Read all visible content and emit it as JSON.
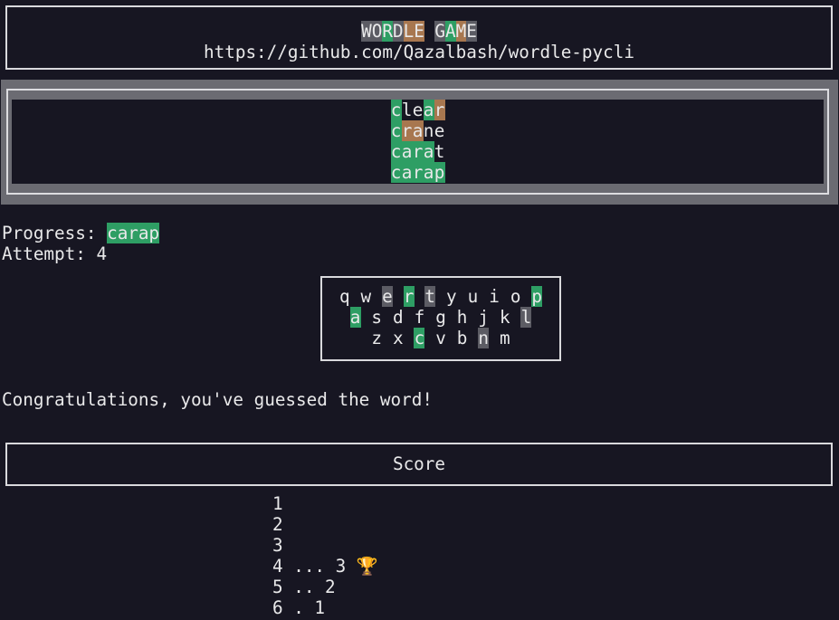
{
  "header": {
    "title_letters": [
      {
        "ch": "W",
        "c": "d"
      },
      {
        "ch": "O",
        "c": "d"
      },
      {
        "ch": "R",
        "c": "g"
      },
      {
        "ch": "D",
        "c": "d"
      },
      {
        "ch": "L",
        "c": "y"
      },
      {
        "ch": "E",
        "c": "y"
      },
      {
        "ch": " ",
        "c": "n"
      },
      {
        "ch": "G",
        "c": "d"
      },
      {
        "ch": "A",
        "c": "g"
      },
      {
        "ch": "M",
        "c": "y"
      },
      {
        "ch": "E",
        "c": "d"
      }
    ],
    "repo_url": "https://github.com/Qazalbash/wordle-pycli"
  },
  "board": {
    "guesses": [
      [
        {
          "ch": "c",
          "c": "g"
        },
        {
          "ch": "l",
          "c": "n"
        },
        {
          "ch": "e",
          "c": "n"
        },
        {
          "ch": "a",
          "c": "g"
        },
        {
          "ch": "r",
          "c": "y"
        }
      ],
      [
        {
          "ch": "c",
          "c": "g"
        },
        {
          "ch": "r",
          "c": "y"
        },
        {
          "ch": "a",
          "c": "y"
        },
        {
          "ch": "n",
          "c": "n"
        },
        {
          "ch": "e",
          "c": "n"
        }
      ],
      [
        {
          "ch": "c",
          "c": "g"
        },
        {
          "ch": "a",
          "c": "g"
        },
        {
          "ch": "r",
          "c": "g"
        },
        {
          "ch": "a",
          "c": "g"
        },
        {
          "ch": "t",
          "c": "n"
        }
      ],
      [
        {
          "ch": "c",
          "c": "g"
        },
        {
          "ch": "a",
          "c": "g"
        },
        {
          "ch": "r",
          "c": "g"
        },
        {
          "ch": "a",
          "c": "g"
        },
        {
          "ch": "p",
          "c": "g"
        }
      ]
    ]
  },
  "status": {
    "progress_label": "Progress: ",
    "progress_word": "carap",
    "attempt_text": "Attempt: 4",
    "congrats": "Congratulations, you've guessed the word!"
  },
  "keyboard": {
    "rows": [
      [
        {
          "ch": "q",
          "c": "n"
        },
        {
          "ch": "w",
          "c": "n"
        },
        {
          "ch": "e",
          "c": "d"
        },
        {
          "ch": "r",
          "c": "g"
        },
        {
          "ch": "t",
          "c": "d"
        },
        {
          "ch": "y",
          "c": "n"
        },
        {
          "ch": "u",
          "c": "n"
        },
        {
          "ch": "i",
          "c": "n"
        },
        {
          "ch": "o",
          "c": "n"
        },
        {
          "ch": "p",
          "c": "g"
        }
      ],
      [
        {
          "ch": "a",
          "c": "g"
        },
        {
          "ch": "s",
          "c": "n"
        },
        {
          "ch": "d",
          "c": "n"
        },
        {
          "ch": "f",
          "c": "n"
        },
        {
          "ch": "g",
          "c": "n"
        },
        {
          "ch": "h",
          "c": "n"
        },
        {
          "ch": "j",
          "c": "n"
        },
        {
          "ch": "k",
          "c": "n"
        },
        {
          "ch": "l",
          "c": "d"
        }
      ],
      [
        {
          "ch": "z",
          "c": "n"
        },
        {
          "ch": "x",
          "c": "n"
        },
        {
          "ch": "c",
          "c": "g"
        },
        {
          "ch": "v",
          "c": "n"
        },
        {
          "ch": "b",
          "c": "n"
        },
        {
          "ch": "n",
          "c": "d"
        },
        {
          "ch": "m",
          "c": "n"
        }
      ]
    ]
  },
  "score": {
    "title": "Score",
    "lines": [
      "1",
      "2",
      "3",
      "4 ... 3 🏆",
      "5 .. 2",
      "6 . 1"
    ]
  },
  "colors": {
    "background": "#171622",
    "correct": "#2e9e64",
    "present": "#a8774f",
    "absent": "#5c5c64"
  }
}
